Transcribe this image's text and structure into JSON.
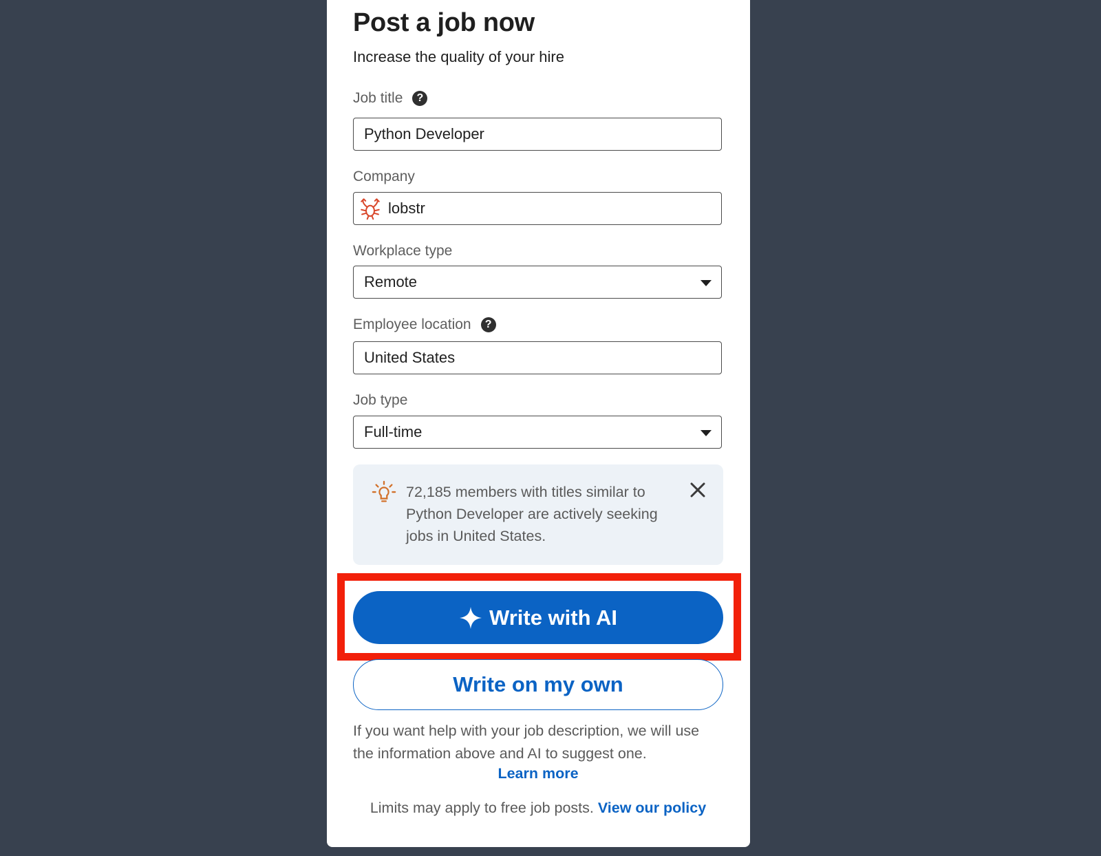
{
  "header": {
    "title": "Post a job now",
    "subtitle": "Increase the quality of your hire"
  },
  "fields": {
    "job_title": {
      "label": "Job title",
      "value": "Python Developer"
    },
    "company": {
      "label": "Company",
      "value": "lobstr"
    },
    "workplace_type": {
      "label": "Workplace type",
      "value": "Remote"
    },
    "employee_location": {
      "label": "Employee location",
      "value": "United States"
    },
    "job_type": {
      "label": "Job type",
      "value": "Full-time"
    }
  },
  "help_icon": {
    "glyph": "?"
  },
  "insight": {
    "text": "72,185 members with titles similar to Python Developer are actively seeking jobs in United States."
  },
  "actions": {
    "write_with_ai": "Write with AI",
    "write_on_own": "Write on my own"
  },
  "footer": {
    "help_text": "If you want help with your job description, we will use the information above and AI to suggest one.",
    "learn_more": "Learn more",
    "limits_text": "Limits may apply to free job posts.",
    "policy_link": "View our policy"
  },
  "colors": {
    "primary": "#0b63c4",
    "highlight": "#f2200a",
    "background": "#38414f",
    "info_box": "#edf2f7",
    "logo": "#d9472b",
    "bulb": "#d2712a"
  }
}
